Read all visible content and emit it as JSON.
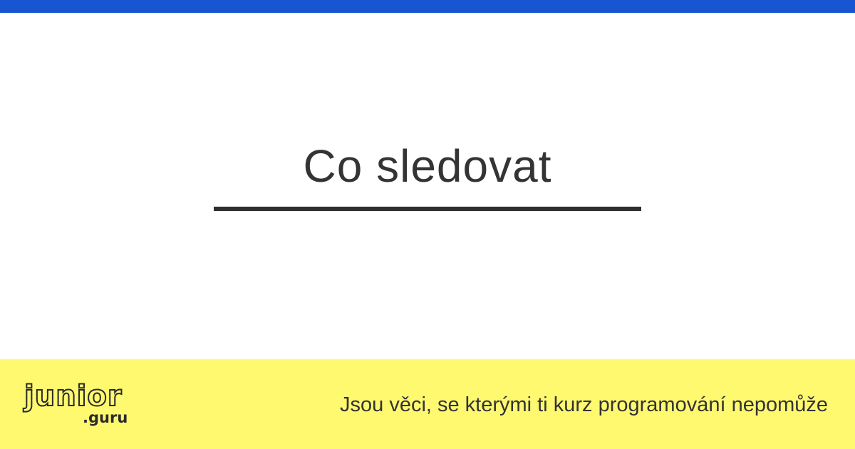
{
  "header": {
    "accent_color": "#1755d1"
  },
  "main": {
    "title": "Co sledovat",
    "title_color": "#343434",
    "rule_color": "#2f2f2f"
  },
  "footer": {
    "background_color": "#fff970",
    "logo": {
      "word": "junior",
      "sub": ".guru"
    },
    "tagline": "Jsou věci, se kterými ti kurz programování nepomůže"
  }
}
